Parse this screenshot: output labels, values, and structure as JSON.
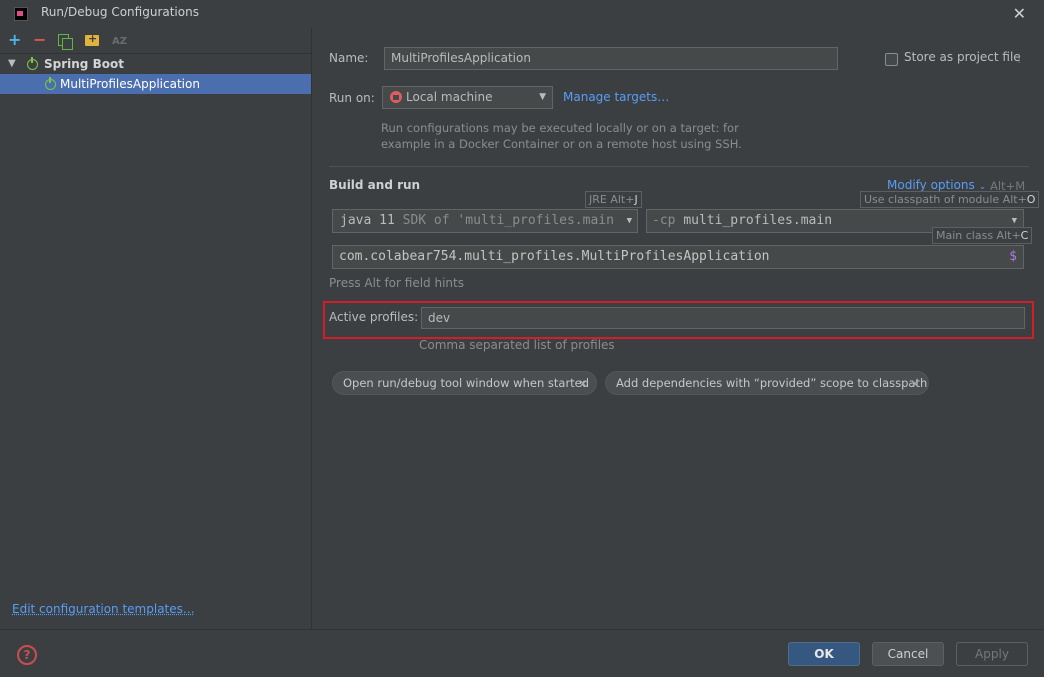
{
  "window": {
    "title": "Run/Debug Configurations"
  },
  "toolbar": {
    "add": "+",
    "remove": "−",
    "sort": "AZ"
  },
  "tree": {
    "group_label": "Spring Boot",
    "item_label": "MultiProfilesApplication"
  },
  "left": {
    "edit_templates": "Edit configuration templates…"
  },
  "form": {
    "name_label": "Name:",
    "name_value": "MultiProfilesApplication",
    "store_label": "Store as project file",
    "run_on_label": "Run on:",
    "run_on_value": "Local machine",
    "manage_targets": "Manage targets…",
    "run_on_hint_1": "Run configurations may be executed locally or on a target: for",
    "run_on_hint_2": "example in a Docker Container or on a remote host using SSH.",
    "section_title": "Build and run",
    "modify_options": "Modify options",
    "modify_shortcut": "Alt+M",
    "jre_badge_label": "JRE Alt+",
    "jre_badge_key": "J",
    "classpath_badge_label": "Use classpath of module Alt+",
    "classpath_badge_key": "O",
    "main_class_badge_label": "Main class Alt+",
    "main_class_badge_key": "C",
    "jre_value_main": "java 11",
    "jre_value_dim": "SDK of 'multi_profiles.main",
    "cp_prefix": "-cp",
    "cp_value": "multi_profiles.main",
    "main_class_value": "com.colabear754.multi_profiles.MultiProfilesApplication",
    "field_hint": "Press Alt for field hints",
    "active_profiles_label": "Active profiles:",
    "active_profiles_value": "dev",
    "active_profiles_hint": "Comma separated list of profiles"
  },
  "chips": [
    {
      "label": "Open run/debug tool window when started"
    },
    {
      "label": "Add dependencies with “provided” scope to classpath"
    }
  ],
  "buttons": {
    "ok": "OK",
    "cancel": "Cancel",
    "apply": "Apply"
  },
  "colors": {
    "accent": "#4b6eaf",
    "link": "#589df6",
    "highlight": "#d01f2b"
  }
}
